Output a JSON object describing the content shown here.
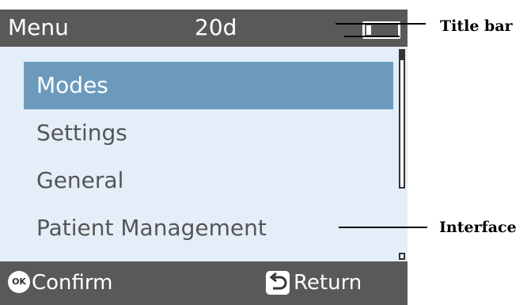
{
  "title_bar": {
    "menu_label": "Menu",
    "count": "20d",
    "battery_icon": "battery-icon"
  },
  "menu": {
    "items": [
      {
        "label": "Modes",
        "selected": true
      },
      {
        "label": "Settings",
        "selected": false
      },
      {
        "label": "General",
        "selected": false
      },
      {
        "label": "Patient Management",
        "selected": false
      }
    ]
  },
  "soft_keys": {
    "confirm_icon_text": "OK",
    "confirm_label": "Confirm",
    "return_label": "Return",
    "return_icon": "return-arrow-icon"
  },
  "callouts": {
    "title_bar": "Title bar",
    "interface": "Interface"
  },
  "colors": {
    "bar_background": "#5a5959",
    "screen_background": "#e4eef8",
    "selected_background": "#6b9abd"
  }
}
